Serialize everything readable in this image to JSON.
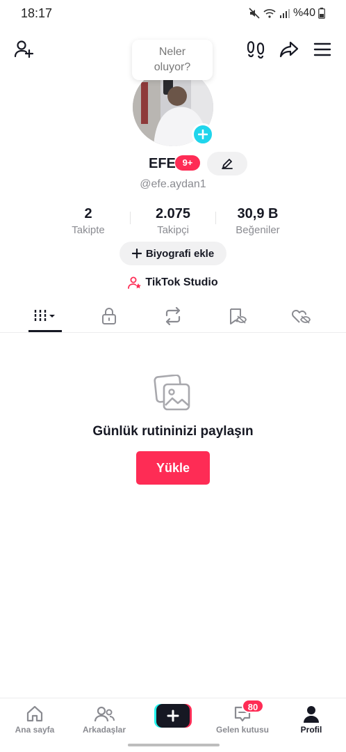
{
  "status_bar": {
    "time": "18:17",
    "battery": "%40"
  },
  "header": {
    "add_friend_icon": "person-plus-icon",
    "footprints_icon": "footprints-icon",
    "share_icon": "share-arrow-icon",
    "menu_icon": "hamburger-menu-icon"
  },
  "status_bubble": {
    "line1": "Neler",
    "line2": "oluyor?"
  },
  "profile": {
    "name": "EFE",
    "badge": "9+",
    "handle": "@efe.aydan1",
    "stats": [
      {
        "value": "2",
        "label": "Takipte"
      },
      {
        "value": "2.075",
        "label": "Takipçi"
      },
      {
        "value": "30,9 B",
        "label": "Beğeniler"
      }
    ],
    "bio_button": "Biyografi ekle",
    "studio_link": "TikTok Studio"
  },
  "tabs": [
    {
      "icon": "grid-videos-icon",
      "active": true
    },
    {
      "icon": "lock-icon",
      "active": false
    },
    {
      "icon": "repost-icon",
      "active": false
    },
    {
      "icon": "bookmark-hidden-icon",
      "active": false
    },
    {
      "icon": "liked-hidden-icon",
      "active": false
    }
  ],
  "empty_state": {
    "title": "Günlük rutininizi paylaşın",
    "button": "Yükle"
  },
  "bottom_nav": {
    "home": "Ana sayfa",
    "friends": "Arkadaşlar",
    "inbox": "Gelen kutusu",
    "inbox_badge": "80",
    "profile": "Profil"
  },
  "colors": {
    "accent": "#fe2c55",
    "cyan": "#20d5ec",
    "text": "#161823",
    "muted": "#8a8b91"
  }
}
